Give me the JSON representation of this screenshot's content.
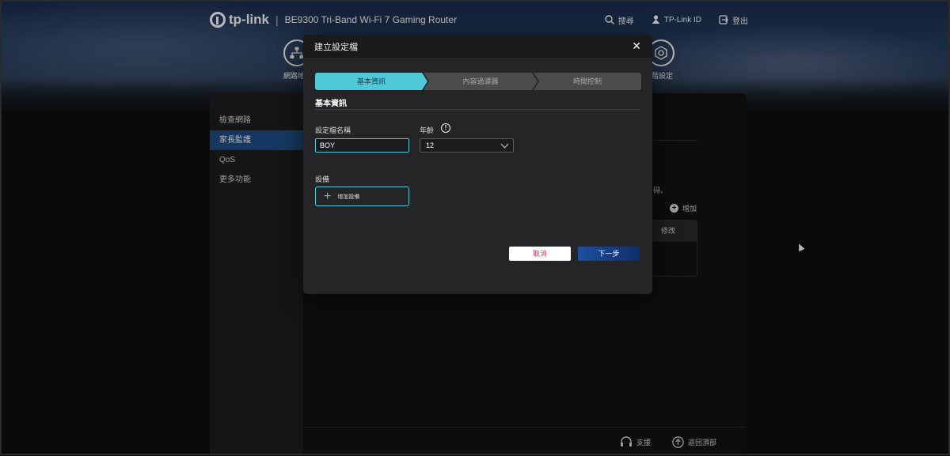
{
  "header": {
    "brand": "tp-link",
    "separator": "|",
    "model": "BE9300 Tri-Band Wi-Fi 7 Gaming Router",
    "actions": [
      {
        "label": "搜尋",
        "icon": "search-icon"
      },
      {
        "label": "TP-Link ID",
        "icon": "user-icon"
      },
      {
        "label": "登出",
        "icon": "logout-icon"
      }
    ]
  },
  "nav": {
    "left_label": "網路地",
    "right_label": "階設定"
  },
  "sidebar": {
    "items": [
      {
        "label": "檢查網路",
        "active": false
      },
      {
        "label": "家長監護",
        "active": true
      },
      {
        "label": "QoS",
        "active": false
      },
      {
        "label": "更多功能",
        "active": false
      }
    ]
  },
  "background": {
    "text_fragment": "碍。",
    "add_label": "增加",
    "table_header": "修改"
  },
  "footer": {
    "support": "支援",
    "back_to_top": "返回頂部"
  },
  "modal": {
    "title": "建立設定檔",
    "close": "✕",
    "steps": [
      {
        "label": "基本資訊",
        "active": true
      },
      {
        "label": "內容過濾器",
        "active": false
      },
      {
        "label": "時間控制",
        "active": false
      }
    ],
    "section_title": "基本資訊",
    "profile_name_label": "設定檔名稱",
    "profile_name_value": "BOY",
    "age_label": "年齡",
    "age_value": "12",
    "device_label": "設備",
    "add_device": "增加設備",
    "cancel": "取消",
    "next": "下一步"
  },
  "colors": {
    "accent_cyan": "#4fc9d6",
    "active_blue": "#1f4e86",
    "next_blue": "#1d4fa0",
    "cancel_text": "#dd3366"
  }
}
